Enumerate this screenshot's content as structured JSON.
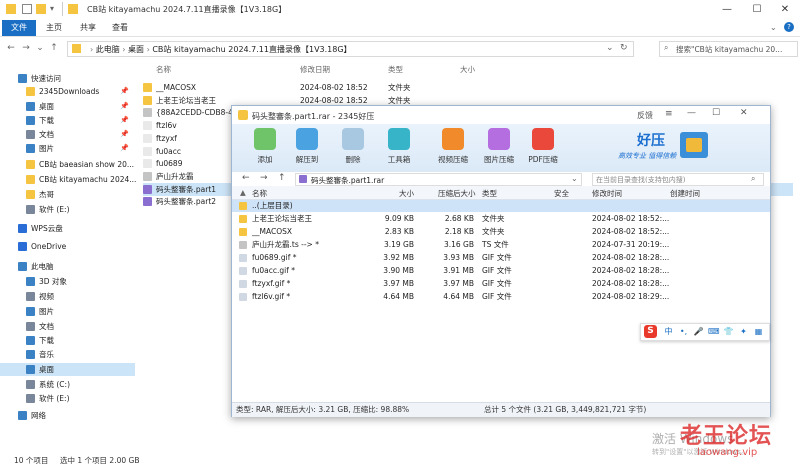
{
  "explorer": {
    "title": "CB站 kitayamachu 2024.7.11直播录像【1V3.18G】",
    "tabs": [
      "文件",
      "主页",
      "共享",
      "查看"
    ],
    "address": [
      "此电脑",
      "桌面",
      "CB站 kitayamachu 2024.7.11直播录像【1V3.18G】"
    ],
    "search_placeholder": "搜索\"CB站 kitayamachu 20...",
    "sidebar": [
      {
        "label": "快速访问",
        "pinned": false,
        "color": "#3b82c4"
      },
      {
        "label": "2345Downloads",
        "pinned": true,
        "color": "#f5c542"
      },
      {
        "label": "桌面",
        "pinned": true,
        "color": "#3b82c4"
      },
      {
        "label": "下载",
        "pinned": true,
        "color": "#3b82c4"
      },
      {
        "label": "文档",
        "pinned": true,
        "color": "#7a8699"
      },
      {
        "label": "图片",
        "pinned": true,
        "color": "#3b82c4"
      },
      {
        "label": "CB站 baeasian show 20...",
        "pinned": false,
        "color": "#f5c542"
      },
      {
        "label": "CB站 kitayamachu 2024...",
        "pinned": false,
        "color": "#f5c542"
      },
      {
        "label": "杰哥",
        "pinned": false,
        "color": "#f5c542"
      },
      {
        "label": "软件 (E:)",
        "pinned": false,
        "color": "#7a8699"
      },
      {
        "label": "WPS云盘",
        "pinned": false,
        "color": "#2b6dd6"
      },
      {
        "label": "OneDrive",
        "pinned": false,
        "color": "#2b6dd6"
      },
      {
        "label": "此电脑",
        "pinned": false,
        "color": "#3b82c4"
      },
      {
        "label": "3D 对象",
        "pinned": false,
        "color": "#3b82c4"
      },
      {
        "label": "视频",
        "pinned": false,
        "color": "#7a8699"
      },
      {
        "label": "图片",
        "pinned": false,
        "color": "#3b82c4"
      },
      {
        "label": "文档",
        "pinned": false,
        "color": "#7a8699"
      },
      {
        "label": "下载",
        "pinned": false,
        "color": "#3b82c4"
      },
      {
        "label": "音乐",
        "pinned": false,
        "color": "#3b82c4"
      },
      {
        "label": "桌面",
        "pinned": false,
        "color": "#3b82c4",
        "selected": true
      },
      {
        "label": "系统 (C:)",
        "pinned": false,
        "color": "#7a8699"
      },
      {
        "label": "软件 (E:)",
        "pinned": false,
        "color": "#7a8699"
      },
      {
        "label": "网络",
        "pinned": false,
        "color": "#3b82c4"
      }
    ],
    "columns": [
      "名称",
      "修改日期",
      "类型",
      "大小"
    ],
    "files": [
      {
        "name": "__MACOSX",
        "date": "2024-08-02 18:52",
        "type": "文件夹",
        "color": "#f5c542"
      },
      {
        "name": "上老王论坛当老王",
        "date": "2024-08-02 18:52",
        "type": "文件夹",
        "color": "#f5c542"
      },
      {
        "name": "{88A2CEDD-CDB8-4f5...",
        "date": "",
        "type": "",
        "color": "#c4c4c4"
      },
      {
        "name": "ftzl6v",
        "date": "",
        "type": "",
        "color": "#e9e9e9"
      },
      {
        "name": "ftzyxf",
        "date": "",
        "type": "",
        "color": "#e9e9e9"
      },
      {
        "name": "fu0acc",
        "date": "",
        "type": "",
        "color": "#e9e9e9"
      },
      {
        "name": "fu0689",
        "date": "",
        "type": "",
        "color": "#e9e9e9"
      },
      {
        "name": "庐山升龙霸",
        "date": "",
        "type": "",
        "color": "#c4c4c4"
      },
      {
        "name": "码头整審条.part1",
        "date": "",
        "type": "",
        "color": "#8a6fd1",
        "selected": true
      },
      {
        "name": "码头整審条.part2",
        "date": "",
        "type": "",
        "color": "#8a6fd1"
      }
    ],
    "status": [
      "10 个项目",
      "选中 1 个项目 2.00 GB"
    ]
  },
  "rar": {
    "title": "码头整審条.part1.rar - 2345好压",
    "feedback": "反馈",
    "tools": [
      {
        "label": "添加",
        "color": "#6fc46a"
      },
      {
        "label": "解压到",
        "color": "#4aa3e0"
      },
      {
        "label": "删除",
        "color": "#a8c7e0"
      },
      {
        "label": "工具箱",
        "color": "#38b4c9"
      },
      {
        "label": "视频压缩",
        "color": "#f08a2a"
      },
      {
        "label": "图片压缩",
        "color": "#b46ee0"
      },
      {
        "label": "PDF压缩",
        "color": "#e9483a"
      }
    ],
    "brand": "好压",
    "slogan": "高效专业  值得信赖",
    "path": "码头整審条.part1.rar",
    "search_placeholder": "在当前目录查找(支持包内搜)",
    "columns": [
      "名称",
      "大小",
      "压缩后大小",
      "类型",
      "安全",
      "修改时间",
      "创建时间"
    ],
    "rows": [
      {
        "name": "..(上层目录)",
        "size": "",
        "packed": "",
        "type": "",
        "mtime": "",
        "color": "#f5c542",
        "selected": true
      },
      {
        "name": "上老王论坛当老王",
        "size": "9.09 KB",
        "packed": "2.68 KB",
        "type": "文件夹",
        "mtime": "2024-08-02 18:52:...",
        "color": "#f5c542"
      },
      {
        "name": "__MACOSX",
        "size": "2.83 KB",
        "packed": "2.18 KB",
        "type": "文件夹",
        "mtime": "2024-08-02 18:52:...",
        "color": "#f5c542"
      },
      {
        "name": "庐山升龙霸.ts --> *",
        "size": "3.19 GB",
        "packed": "3.16 GB",
        "type": "TS 文件",
        "mtime": "2024-07-31 20:19:...",
        "color": "#c4c4c4"
      },
      {
        "name": "fu0689.gif *",
        "size": "3.92 MB",
        "packed": "3.93 MB",
        "type": "GIF 文件",
        "mtime": "2024-08-02 18:28:...",
        "color": "#cfd8e3"
      },
      {
        "name": "fu0acc.gif *",
        "size": "3.90 MB",
        "packed": "3.91 MB",
        "type": "GIF 文件",
        "mtime": "2024-08-02 18:28:...",
        "color": "#cfd8e3"
      },
      {
        "name": "ftzyxf.gif *",
        "size": "3.97 MB",
        "packed": "3.97 MB",
        "type": "GIF 文件",
        "mtime": "2024-08-02 18:28:...",
        "color": "#cfd8e3"
      },
      {
        "name": "ftzl6v.gif *",
        "size": "4.64 MB",
        "packed": "4.64 MB",
        "type": "GIF 文件",
        "mtime": "2024-08-02 18:29:...",
        "color": "#cfd8e3"
      }
    ],
    "status_left": "类型: RAR, 解压后大小: 3.21 GB, 压缩比: 98.88%",
    "status_right": "总计 5 个文件 (3.21 GB, 3,449,821,721 字节)"
  },
  "ime": {
    "logo": "S",
    "items": [
      "中",
      "•,",
      "🎤",
      "⌨",
      "👕",
      "✦",
      "▦"
    ]
  },
  "watermark": {
    "line1": "激活 Windows",
    "line2": "转到\"设置\"以激活 Windows。",
    "logo": "老王论坛",
    "logo_url": "laowang.vip"
  },
  "colors": {
    "accent": "#1a6fc4",
    "selection": "#cce4f7"
  }
}
